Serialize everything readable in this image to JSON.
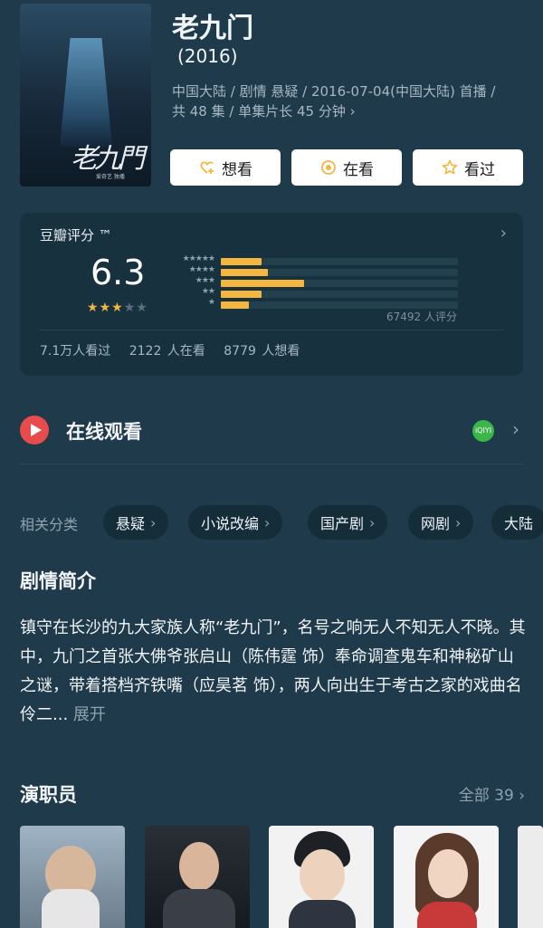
{
  "show": {
    "title": "老九门",
    "year": "(2016)",
    "meta_line1": "中国大陆 / 剧情 悬疑 / 2016-07-04(中国大陆) 首播 /",
    "meta_line2": "共 48 集 / 单集片长 45 分钟 ›",
    "poster": {
      "calligraphy": "老九門",
      "subtitle": "爱奇艺 独播"
    }
  },
  "actions": [
    {
      "label": "想看",
      "icon": "add-heart-icon"
    },
    {
      "label": "在看",
      "icon": "target-icon"
    },
    {
      "label": "看过",
      "icon": "star-outline-icon"
    }
  ],
  "rating": {
    "label": "豆瓣评分 ™",
    "score": "6.3",
    "stars_filled": 3,
    "stars_total": 5,
    "distribution": [
      {
        "stars": "★★★★★",
        "fraction": 0.17
      },
      {
        "stars": "★★★★",
        "fraction": 0.2
      },
      {
        "stars": "★★★",
        "fraction": 0.35
      },
      {
        "stars": "★★",
        "fraction": 0.17
      },
      {
        "stars": "★",
        "fraction": 0.12
      }
    ],
    "count_text": "67492 人评分",
    "stats": {
      "watched": "7.1万人看过",
      "watching": "2122 人在看",
      "want": "8779 人想看"
    },
    "colors": {
      "filled": "#f5b640",
      "track": "#23404f"
    }
  },
  "watch": {
    "label": "在线观看",
    "platform_icon": "iqiyi-icon",
    "platform_text": "iQIYI"
  },
  "categories": {
    "label": "相关分类",
    "items": [
      "悬疑",
      "小说改编",
      "国产剧",
      "网剧",
      "大陆"
    ]
  },
  "synopsis": {
    "title": "剧情简介",
    "text": "镇守在长沙的九大家族人称“老九门”，名号之响无人不知无人不晓。其中，九门之首张大佛爷张启山（陈伟霆 饰）奉命调查鬼车和神秘矿山之谜，带着搭档齐铁嘴（应昊茗 饰），两人向出生于考古之家的戏曲名伶二...",
    "more": "展开"
  },
  "cast": {
    "title": "演职员",
    "all": "全部 39 ›"
  }
}
